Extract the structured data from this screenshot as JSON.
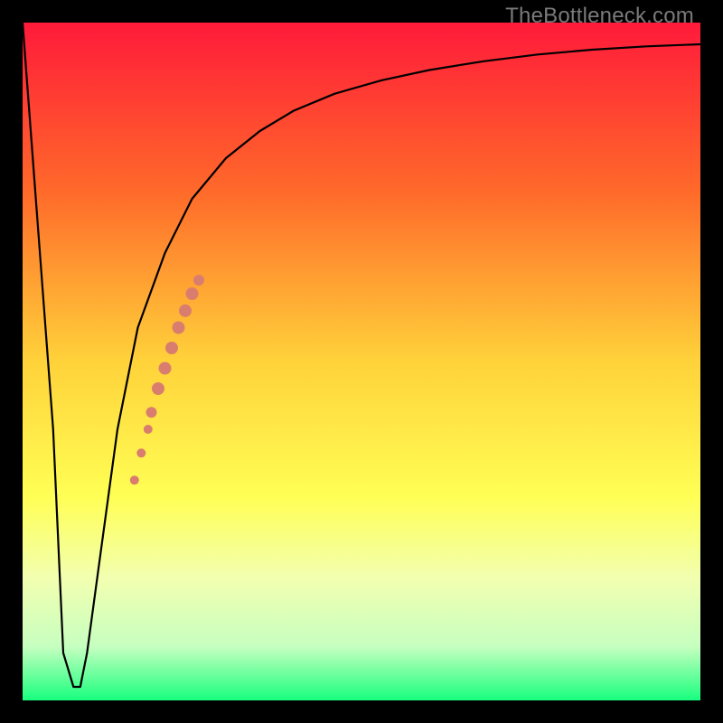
{
  "watermark": "TheBottleneck.com",
  "chart_data": {
    "type": "line",
    "title": "",
    "xlabel": "",
    "ylabel": "",
    "xlim": [
      0,
      100
    ],
    "ylim": [
      0,
      100
    ],
    "grid": false,
    "legend": false,
    "background_gradient": {
      "stops": [
        {
          "offset": 0.0,
          "color": "#ff1a3a"
        },
        {
          "offset": 0.25,
          "color": "#ff6a2a"
        },
        {
          "offset": 0.5,
          "color": "#ffd23a"
        },
        {
          "offset": 0.7,
          "color": "#ffff55"
        },
        {
          "offset": 0.82,
          "color": "#f2ffb0"
        },
        {
          "offset": 0.92,
          "color": "#c7ffc0"
        },
        {
          "offset": 1.0,
          "color": "#18ff7e"
        }
      ]
    },
    "series": [
      {
        "name": "bottleneck-curve",
        "color": "#000000",
        "stroke_width": 2.2,
        "x": [
          0,
          4.5,
          6.0,
          7.5,
          8.5,
          9.5,
          11,
          14,
          17,
          21,
          25,
          30,
          35,
          40,
          46,
          53,
          60,
          68,
          76,
          84,
          92,
          100
        ],
        "y": [
          100,
          40,
          7,
          2,
          2,
          7,
          18,
          40,
          55,
          66,
          74,
          80,
          84,
          87,
          89.5,
          91.5,
          93,
          94.3,
          95.3,
          96,
          96.5,
          96.8
        ]
      }
    ],
    "markers": {
      "name": "highlight-dots",
      "color": "#d97e6e",
      "points": [
        {
          "x": 16.5,
          "y": 32.5,
          "r": 5
        },
        {
          "x": 17.5,
          "y": 36.5,
          "r": 5
        },
        {
          "x": 18.5,
          "y": 40.0,
          "r": 5
        },
        {
          "x": 19.0,
          "y": 42.5,
          "r": 6
        },
        {
          "x": 20.0,
          "y": 46.0,
          "r": 7
        },
        {
          "x": 21.0,
          "y": 49.0,
          "r": 7
        },
        {
          "x": 22.0,
          "y": 52.0,
          "r": 7
        },
        {
          "x": 23.0,
          "y": 55.0,
          "r": 7
        },
        {
          "x": 24.0,
          "y": 57.5,
          "r": 7
        },
        {
          "x": 25.0,
          "y": 60.0,
          "r": 7
        },
        {
          "x": 26.0,
          "y": 62.0,
          "r": 6
        }
      ]
    }
  }
}
